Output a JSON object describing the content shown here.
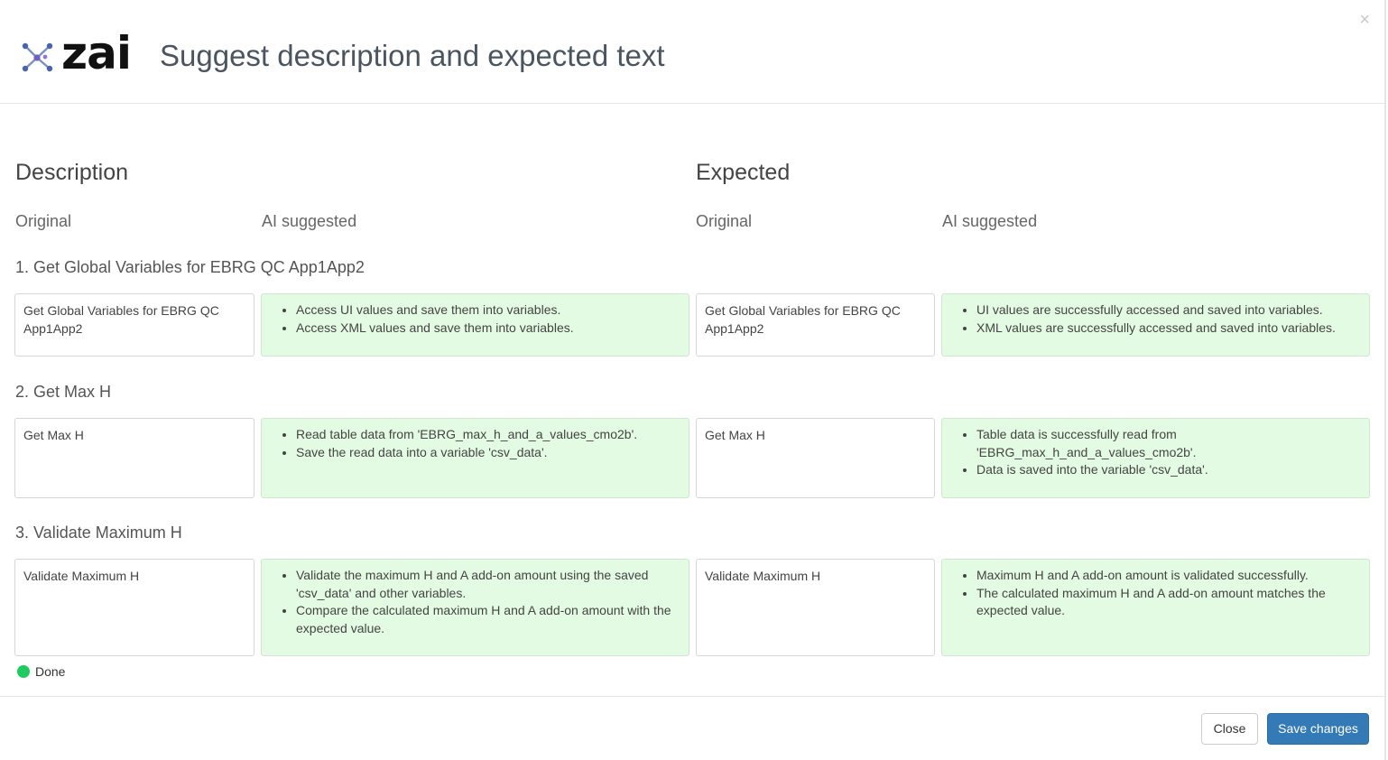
{
  "header": {
    "logo_text": "zai",
    "title": "Suggest description and expected text",
    "close_symbol": "×"
  },
  "description": {
    "title": "Description",
    "original_label": "Original",
    "ai_label": "AI suggested"
  },
  "expected": {
    "title": "Expected",
    "original_label": "Original",
    "ai_label": "AI suggested"
  },
  "steps": [
    {
      "title": "1. Get Global Variables for EBRG QC App1App2",
      "desc_original": "Get Global Variables for EBRG QC App1App2",
      "desc_ai": [
        "Access UI values and save them into variables.",
        "Access XML values and save them into variables."
      ],
      "exp_original": "Get Global Variables for EBRG QC App1App2",
      "exp_ai": [
        "UI values are successfully accessed and saved into variables.",
        "XML values are successfully accessed and saved into variables."
      ]
    },
    {
      "title": "2. Get Max H",
      "desc_original": "Get Max H",
      "desc_ai": [
        "Read table data from 'EBRG_max_h_and_a_values_cmo2b'.",
        "Save the read data into a variable 'csv_data'."
      ],
      "exp_original": "Get Max H",
      "exp_ai": [
        "Table data is successfully read from 'EBRG_max_h_and_a_values_cmo2b'.",
        "Data is saved into the variable 'csv_data'."
      ]
    },
    {
      "title": "3. Validate Maximum H",
      "desc_original": "Validate Maximum H",
      "desc_ai": [
        "Validate the maximum H and A add-on amount using the saved 'csv_data' and other variables.",
        "Compare the calculated maximum H and A add-on amount with the expected value."
      ],
      "exp_original": "Validate Maximum H",
      "exp_ai": [
        "Maximum H and A add-on amount is validated successfully.",
        "The calculated maximum H and A add-on amount matches the expected value."
      ]
    }
  ],
  "status": {
    "label": "Done",
    "color": "#1fcb5e"
  },
  "footer": {
    "close_label": "Close",
    "save_label": "Save changes"
  },
  "colors": {
    "primary_button": "#337ab7",
    "ai_box_background": "#e4fbe3"
  }
}
